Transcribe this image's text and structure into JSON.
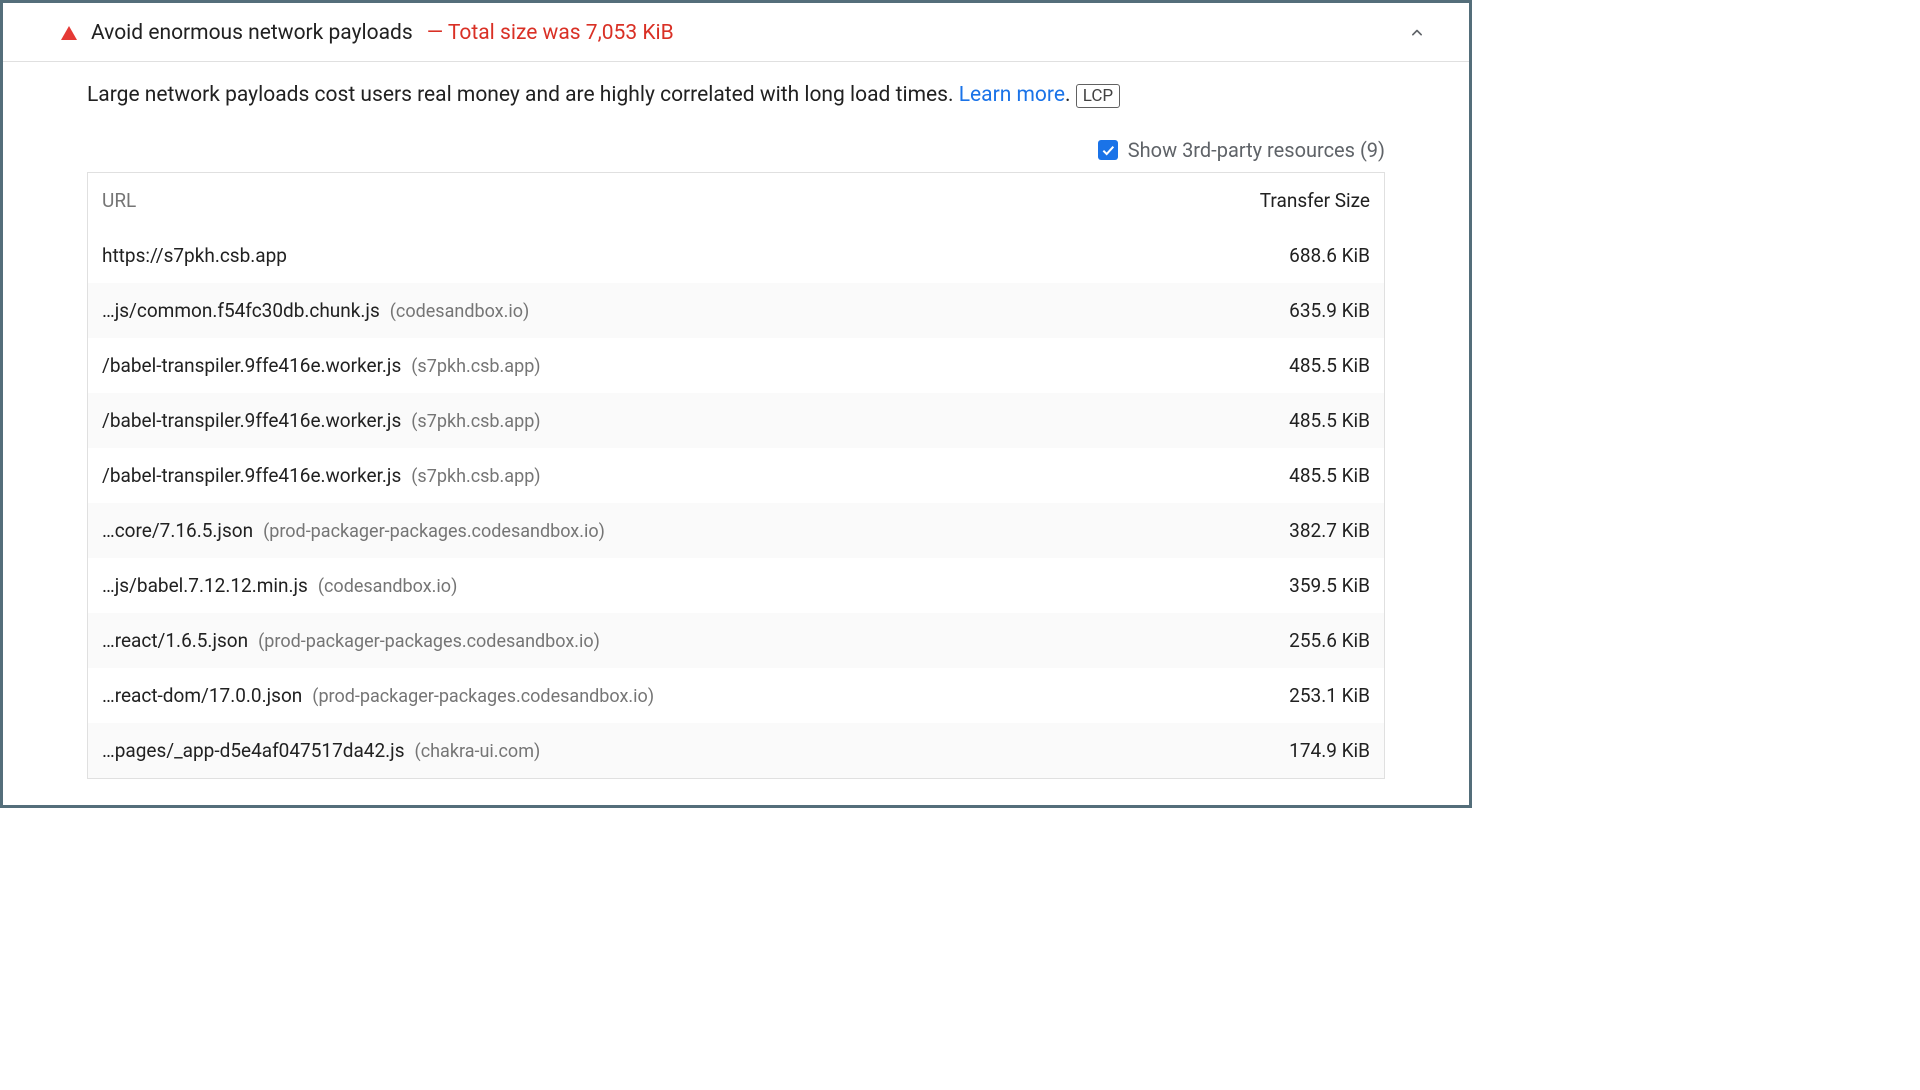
{
  "audit": {
    "title": "Avoid enormous network payloads",
    "summary": "— Total size was 7,053 KiB",
    "description_prefix": "Large network payloads cost users real money and are highly correlated with long load times. ",
    "learn_more": "Learn more",
    "description_suffix": ".",
    "badge": "LCP"
  },
  "toggle": {
    "label": "Show 3rd-party resources (9)"
  },
  "table": {
    "headers": {
      "url": "URL",
      "size": "Transfer Size"
    },
    "rows": [
      {
        "url": "https://s7pkh.csb.app",
        "origin": "",
        "size": "688.6 KiB"
      },
      {
        "url": "…js/common.f54fc30db.chunk.js",
        "origin": "(codesandbox.io)",
        "size": "635.9 KiB"
      },
      {
        "url": "/babel-transpiler.9ffe416e.worker.js",
        "origin": "(s7pkh.csb.app)",
        "size": "485.5 KiB"
      },
      {
        "url": "/babel-transpiler.9ffe416e.worker.js",
        "origin": "(s7pkh.csb.app)",
        "size": "485.5 KiB"
      },
      {
        "url": "/babel-transpiler.9ffe416e.worker.js",
        "origin": "(s7pkh.csb.app)",
        "size": "485.5 KiB"
      },
      {
        "url": "…core/7.16.5.json",
        "origin": "(prod-packager-packages.codesandbox.io)",
        "size": "382.7 KiB"
      },
      {
        "url": "…js/babel.7.12.12.min.js",
        "origin": "(codesandbox.io)",
        "size": "359.5 KiB"
      },
      {
        "url": "…react/1.6.5.json",
        "origin": "(prod-packager-packages.codesandbox.io)",
        "size": "255.6 KiB"
      },
      {
        "url": "…react-dom/17.0.0.json",
        "origin": "(prod-packager-packages.codesandbox.io)",
        "size": "253.1 KiB"
      },
      {
        "url": "…pages/_app-d5e4af047517da42.js",
        "origin": "(chakra-ui.com)",
        "size": "174.9 KiB"
      }
    ]
  }
}
